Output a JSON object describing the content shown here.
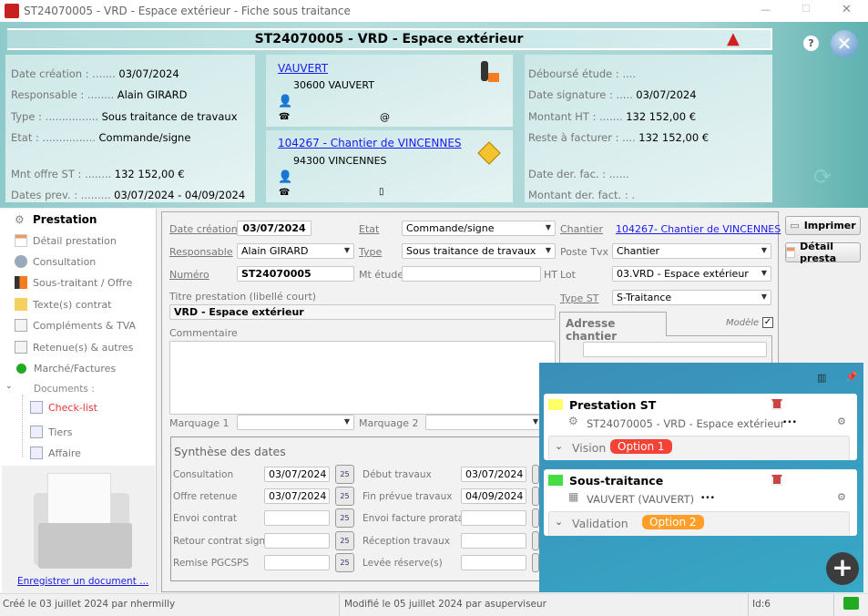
{
  "window": {
    "title": "ST24070005 - VRD - Espace extérieur - Fiche sous traitance",
    "min": "—",
    "max": "☐",
    "close": "✕"
  },
  "header": {
    "title": "ST24070005 - VRD - Espace extérieur",
    "left": [
      {
        "label": "Date création : .......",
        "value": "03/07/2024"
      },
      {
        "label": "Responsable : ........",
        "value": "Alain GIRARD"
      },
      {
        "label": "Type : ................",
        "value": "Sous traitance de travaux"
      },
      {
        "label": "Etat : ................",
        "value": "Commande/signe"
      },
      {
        "label": "Mnt offre ST : ........",
        "value": "132 152,00 €"
      },
      {
        "label": "Dates prev. : .........",
        "value": "03/07/2024 - 04/09/2024"
      }
    ],
    "tiers": {
      "name": "VAUVERT",
      "address": "30600 VAUVERT",
      "email_icon": "@"
    },
    "chantier": {
      "name": "104267 - Chantier de VINCENNES",
      "address": "94300 VINCENNES"
    },
    "right": [
      {
        "label": "Déboursé étude : ....",
        "value": ""
      },
      {
        "label": "Date signature : .....",
        "value": "03/07/2024"
      },
      {
        "label": "Montant HT : .......",
        "value": "132 152,00 €"
      },
      {
        "label": "Reste à facturer : ....",
        "value": "132 152,00 €"
      },
      {
        "label": "Date der. fac. : ......",
        "value": ""
      },
      {
        "label": "Montant der. fact. : .",
        "value": ""
      }
    ],
    "help": "?"
  },
  "sidebar": {
    "title": "Prestation",
    "items": [
      "Détail prestation",
      "Consultation",
      "Sous-traitant / Offre",
      "Texte(s) contrat",
      "Compléments & TVA",
      "Retenue(s) & autres",
      "Marché/Factures"
    ],
    "documents_label": "Documents :",
    "documents": [
      "Check-list",
      "Tiers",
      "Affaire"
    ],
    "save_doc": "Enregistrer un document ..."
  },
  "form": {
    "date_creation_label": "Date création",
    "date_creation": "03/07/2024",
    "etat_label": "Etat",
    "etat": "Commande/signe",
    "chantier_label": "Chantier",
    "chantier": "104267- Chantier de VINCENNES",
    "responsable_label": "Responsable",
    "responsable": "Alain GIRARD",
    "type_label": "Type",
    "type": "Sous traitance de travaux",
    "poste_label": "Poste Tvx",
    "poste": "Chantier",
    "numero_label": "Numéro",
    "numero": "ST24070005",
    "mt_etude_label": "Mt étude",
    "mt_etude": "",
    "ht": "HT",
    "lot_label": "Lot",
    "lot": "03.VRD - Espace extérieur",
    "titre_label": "Titre prestation (libellé court)",
    "titre": "VRD - Espace extérieur",
    "type_st_label": "Type ST",
    "type_st": "S-Traitance",
    "commentaire_label": "Commentaire",
    "commentaire": "",
    "adresse_tab": "Adresse chantier",
    "modele_label": "Modèle",
    "modele_checked": true,
    "marquage1_label": "Marquage 1",
    "marquage2_label": "Marquage 2",
    "synthese_title": "Synthèse des dates",
    "dates_left": [
      {
        "label": "Consultation",
        "value": "03/07/2024"
      },
      {
        "label": "Offre retenue",
        "value": "03/07/2024"
      },
      {
        "label": "Envoi contrat",
        "value": ""
      },
      {
        "label": "Retour contrat signé",
        "value": ""
      },
      {
        "label": "Remise PGCSPS",
        "value": ""
      }
    ],
    "dates_right": [
      {
        "label": "Début travaux",
        "value": "03/07/2024"
      },
      {
        "label": "Fin prévue travaux",
        "value": "04/09/2024"
      },
      {
        "label": "Envoi facture prorata",
        "value": ""
      },
      {
        "label": "Réception travaux",
        "value": ""
      },
      {
        "label": "Levée réserve(s)",
        "value": ""
      }
    ]
  },
  "buttons": {
    "print": "Imprimer",
    "detail": "Détail presta"
  },
  "overlay": {
    "cards": [
      {
        "title": "Prestation ST",
        "sub": "ST24070005 - VRD - Espace extérieur",
        "more": "•••",
        "section": "Vision",
        "badge": "Option 1",
        "badge_color": "#f44336",
        "flag_color": "#ffff66"
      },
      {
        "title": "Sous-traitance",
        "sub": "VAUVERT (VAUVERT)",
        "more": "•••",
        "section": "Validation",
        "badge": "Option 2",
        "badge_color": "#ff9f2a",
        "flag_color": "#44dd44"
      }
    ],
    "add": "+"
  },
  "status": {
    "created": "Créé le 03 juillet 2024 par nhermilly",
    "modified": "Modifié le 05 juillet 2024 par asuperviseur",
    "id": "Id:6"
  }
}
